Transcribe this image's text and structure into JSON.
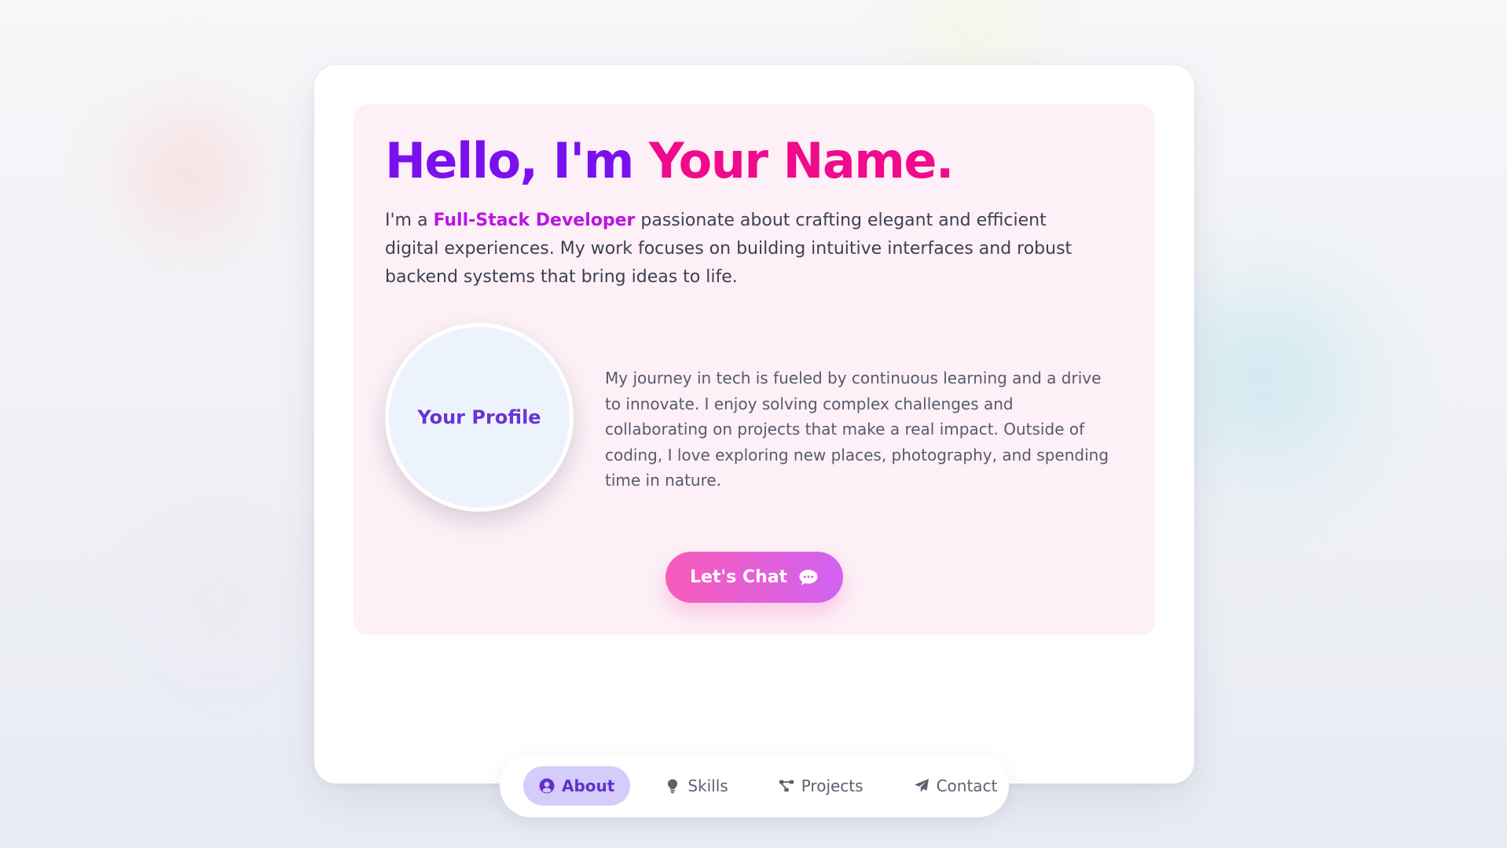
{
  "hero": {
    "greeting": "Hello, I'm ",
    "name": "Your Name."
  },
  "intro": {
    "prefix": "I'm a ",
    "role": "Full-Stack Developer",
    "rest": " passionate about crafting elegant and efficient digital experiences. My work focuses on building intuitive interfaces and robust backend systems that bring ideas to life."
  },
  "profile": {
    "avatar_label": "Your Profile",
    "bio": "My journey in tech is fueled by continuous learning and a drive to innovate. I enjoy solving complex challenges and collaborating on projects that make a real impact. Outside of coding, I love exploring new places, photography, and spending time in nature."
  },
  "cta": {
    "label": "Let's Chat",
    "icon": "chat-bubble-icon"
  },
  "nav": {
    "active": "about",
    "items": [
      {
        "label": "About",
        "icon": "user-circle-icon"
      },
      {
        "label": "Skills",
        "icon": "lightbulb-icon"
      },
      {
        "label": "Projects",
        "icon": "project-diagram-icon"
      },
      {
        "label": "Contact",
        "icon": "paper-plane-icon"
      }
    ]
  },
  "colors": {
    "greeting": "#7b10ee",
    "name": "#f00a8c",
    "role": "#b914e6",
    "accent": "#6330c9",
    "button_gradient": [
      "#f85bb8",
      "#d163f2"
    ]
  }
}
